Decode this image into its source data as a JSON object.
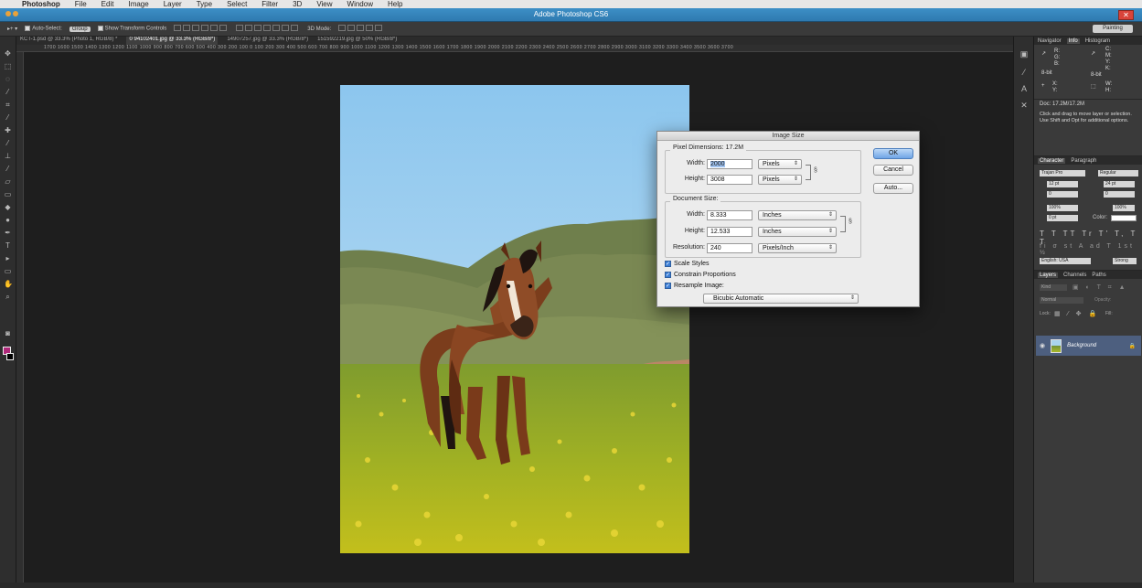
{
  "menubar": {
    "apple": "",
    "app_name": "Photoshop",
    "items": [
      "File",
      "Edit",
      "Image",
      "Layer",
      "Type",
      "Select",
      "Filter",
      "3D",
      "View",
      "Window",
      "Help"
    ]
  },
  "titlebar": {
    "title": "Adobe Photoshop CS6",
    "close": "✕"
  },
  "workspace": "Painting",
  "options_bar": {
    "auto_select": "Auto-Select:",
    "auto_select_value": "Group",
    "show_transform": "Show Transform Controls",
    "mode_3d": "3D Mode:"
  },
  "tabs": [
    "KCT-1.psd @ 33.3% (Photo 1, RGB/8) *",
    "0 94102401.jpg @ 33.3% (RGB/8*)",
    "14907257.jpg @ 33.3% (RGB/8*)",
    "151592219.jpg @ 50% (RGB/8*)"
  ],
  "ruler_numbers": "1700 1600 1500 1400 1300 1200 1100 1000 900 800 700 600 500 400 300 200 100 0 100 200 300 400 500 600 700 800 900 1000 1100 1200 1300 1400 1500 1600 1700 1800 1900 2000 2100 2200 2300 2400 2500 2600 2700 2800 2900 3000 3100 3200 3300 3400 3500 3600 3700",
  "dialog": {
    "title": "Image Size",
    "pixel_dimensions_label": "Pixel Dimensions: 17.2M",
    "pixel": {
      "width_label": "Width:",
      "width_value": "2000",
      "width_unit": "Pixels",
      "height_label": "Height:",
      "height_value": "3008",
      "height_unit": "Pixels"
    },
    "document_size_label": "Document Size:",
    "doc": {
      "width_label": "Width:",
      "width_value": "8.333",
      "width_unit": "Inches",
      "height_label": "Height:",
      "height_value": "12.533",
      "height_unit": "Inches",
      "resolution_label": "Resolution:",
      "resolution_value": "240",
      "resolution_unit": "Pixels/Inch"
    },
    "scale_styles": "Scale Styles",
    "constrain_proportions": "Constrain Proportions",
    "resample_image": "Resample Image:",
    "resample_method": "Bicubic Automatic",
    "ok": "OK",
    "cancel": "Cancel",
    "auto": "Auto..."
  },
  "panels": {
    "top_tabs": [
      "Navigator",
      "Info",
      "Histogram"
    ],
    "info": {
      "r": "R:",
      "g": "G:",
      "b": "B:",
      "bit": "8-bit",
      "c": "C:",
      "m": "M:",
      "y": "Y:",
      "k": "K:",
      "x": "X:",
      "yy": "Y:",
      "w": "W:",
      "h": "H:"
    },
    "doc_label": "Doc: 17.2M/17.2M",
    "hint": "Click and drag to move layer or selection. Use Shift and Opt for additional options.",
    "char_tabs": [
      "Character",
      "Paragraph"
    ],
    "char": {
      "font": "Trajan Pro",
      "style": "Regular",
      "size": "12 pt",
      "leading": "24 pt",
      "kerning": "0",
      "tracking": "0",
      "vscale": "100%",
      "hscale": "100%",
      "baseline": "0 pt",
      "color_label": "Color:",
      "language": "English: USA",
      "aa": "Strong"
    },
    "layers_tabs": [
      "Layers",
      "Channels",
      "Paths"
    ],
    "layers": {
      "kind": "Kind",
      "blend": "Normal",
      "opacity_label": "Opacity:",
      "lock_label": "Lock:",
      "fill_label": "Fill:",
      "layer_name": "Background"
    }
  }
}
